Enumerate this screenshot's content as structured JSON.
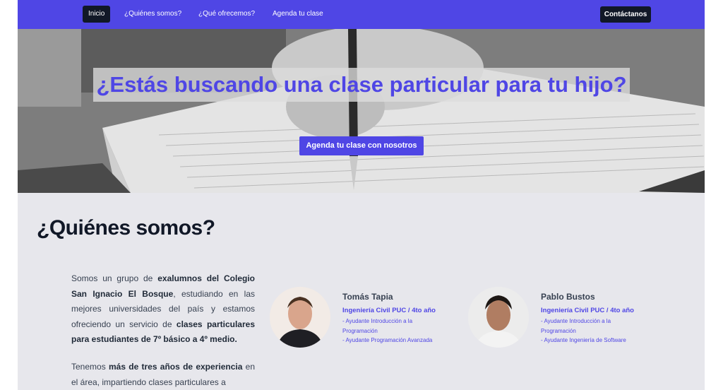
{
  "nav": {
    "links": [
      {
        "label": "Inicio",
        "active": true
      },
      {
        "label": "¿Quiénes somos?",
        "active": false
      },
      {
        "label": "¿Qué ofrecemos?",
        "active": false
      },
      {
        "label": "Agenda tu clase",
        "active": false
      }
    ],
    "contact_label": "Contáctanos"
  },
  "hero": {
    "title": "¿Estás buscando una clase particular para tu hijo?",
    "cta_label": "Agenda tu clase con nosotros"
  },
  "about": {
    "heading": "¿Quiénes somos?",
    "p1": {
      "t1": "Somos un grupo de ",
      "b1": "exalumnos del Colegio San Ignacio El Bosque",
      "t2": ", estudiando en las mejores universidades del país y estamos ofreciendo un servicio de ",
      "b2": "clases particulares para estudiantes de 7º básico a 4º medio."
    },
    "p2": {
      "t1": "Tenemos ",
      "b1": "más de tres años de experiencia",
      "t2": " en el área, impartiendo clases particulares a"
    },
    "members": [
      {
        "name": "Tomás Tapia",
        "degree": "Ingeniería Civil PUC / 4to año",
        "roles": [
          "- Ayudante Introducción a la Programación",
          "- Ayudante Programación Avanzada"
        ]
      },
      {
        "name": "Pablo Bustos",
        "degree": "Ingeniería Civil PUC / 4to año",
        "roles": [
          "- Ayudante Introducción a la Programación",
          "- Ayudante Ingeniería de Software"
        ]
      }
    ]
  },
  "colors": {
    "accent": "#4f46e5",
    "dark_button": "#111827",
    "section_bg": "#e7e7ec"
  }
}
